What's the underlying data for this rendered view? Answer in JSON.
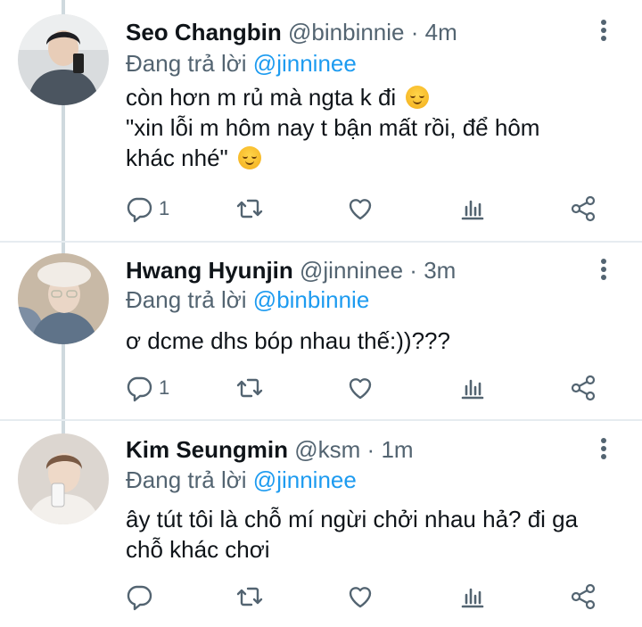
{
  "tweets": [
    {
      "name": "Seo Changbin",
      "handle": "@binbinnie",
      "sep": "·",
      "time": "4m",
      "replying_prefix": "Đang trả lời",
      "replying_to": "@jinninee",
      "lines": [
        "còn hơn m rủ mà ngta k đi",
        "\"xin lỗi m hôm nay t bận mất rồi, để hôm",
        "khác nhé\""
      ],
      "reply_count": "1"
    },
    {
      "name": "Hwang Hyunjin",
      "handle": "@jinninee",
      "sep": "·",
      "time": "3m",
      "replying_prefix": "Đang trả lời",
      "replying_to": "@binbinnie",
      "lines": [
        "ơ dcme dhs bóp nhau thế:))???"
      ],
      "reply_count": "1"
    },
    {
      "name": "Kim Seungmin",
      "handle": "@ksm",
      "sep": "·",
      "time": "1m",
      "replying_prefix": "Đang trả lời",
      "replying_to": "@jinninee",
      "lines": [
        "ây tút tôi là chỗ mí ngừi chởi nhau hả? đi ga",
        "chỗ khác chơi"
      ],
      "reply_count": ""
    }
  ],
  "icons": {
    "reply": "reply-icon",
    "retweet": "retweet-icon",
    "like": "heart-icon",
    "analytics": "analytics-icon",
    "share": "share-icon",
    "more": "more-vertical-icon"
  },
  "colors": {
    "text": "#0f1419",
    "muted": "#536471",
    "mention": "#1d9bf0",
    "thread_line": "#cfd9de"
  }
}
